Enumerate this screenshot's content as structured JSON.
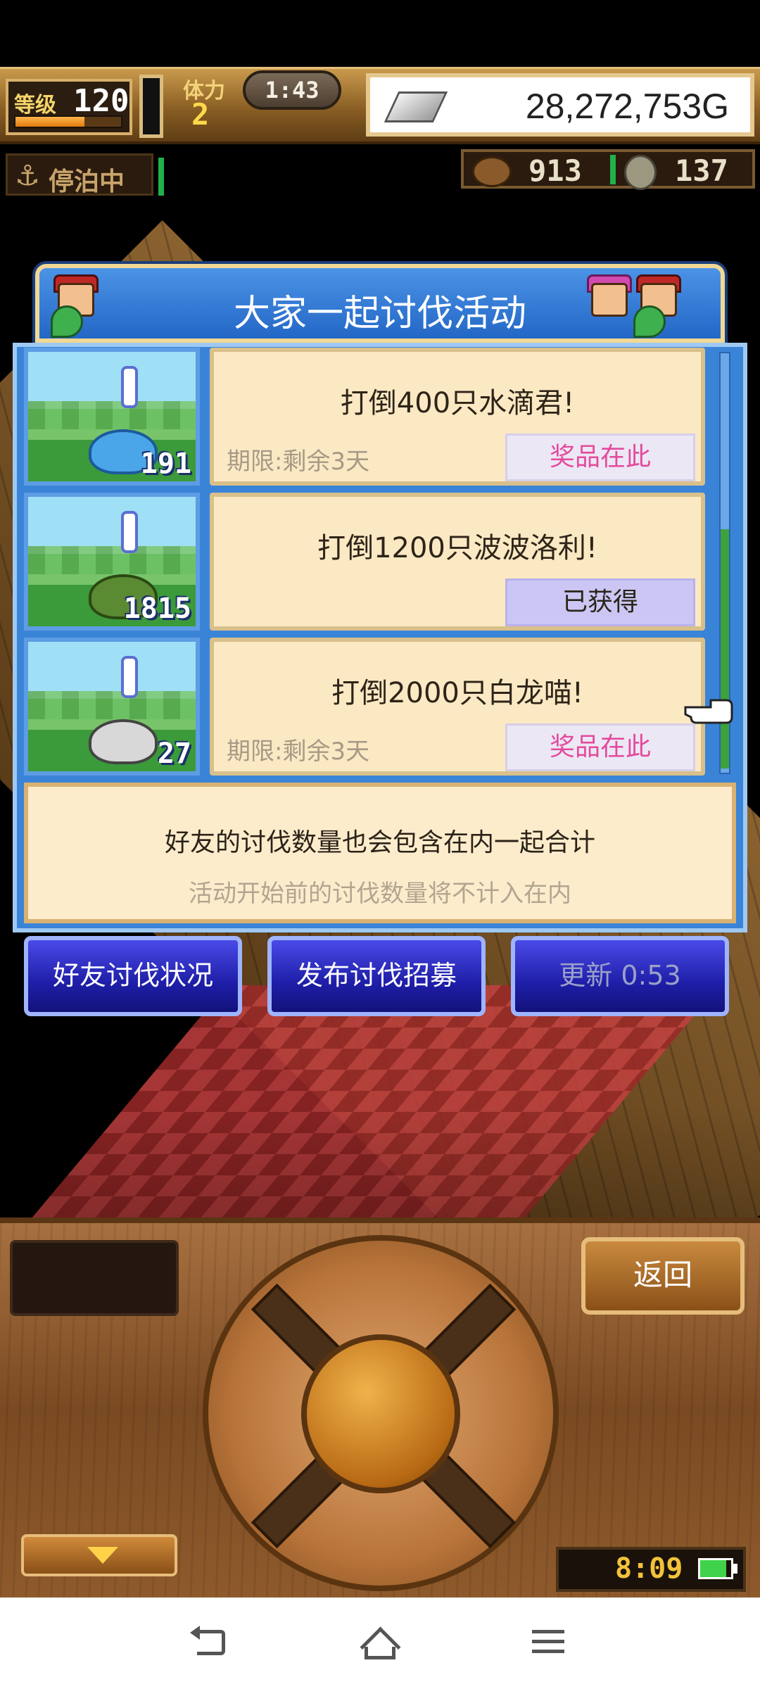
{
  "hud": {
    "level_label": "等级",
    "level_value": "120",
    "exp_fraction": 0.65,
    "stamina_label": "体力",
    "stamina_value": "2",
    "timer": "1:43",
    "gold": "28,272,753G",
    "docked_label": "停泊中",
    "resource_1": "913",
    "resource_2": "137"
  },
  "event": {
    "title": "大家一起讨伐活动",
    "quests": [
      {
        "title": "打倒400只水滴君!",
        "deadline": "期限:剩余3天",
        "reward": "奖品在此",
        "count": "191",
        "monster_icon": "water-droplet-monster-icon",
        "claimed": false
      },
      {
        "title": "打倒1200只波波洛利!",
        "deadline": "",
        "reward": "已获得",
        "count": "1815",
        "monster_icon": "bobo-monster-icon",
        "claimed": true
      },
      {
        "title": "打倒2000只白龙喵!",
        "deadline": "期限:剩余3天",
        "reward": "奖品在此",
        "count": "27",
        "monster_icon": "white-dragon-cat-icon",
        "claimed": false
      }
    ],
    "info_line1": "好友的讨伐数量也会包含在内一起合计",
    "info_line2": "活动开始前的讨伐数量将不计入在内",
    "buttons": {
      "friend_status": "好友讨伐状况",
      "post_recruit": "发布讨伐招募",
      "refresh": "更新 0:53"
    }
  },
  "controls": {
    "return_label": "返回",
    "clock": "8:09",
    "battery_fraction": 0.85
  },
  "colors": {
    "panel_blue": "#3a84d8",
    "card_cream": "#fbe9c4",
    "reward_pink": "#e44a9c",
    "button_blue": "#1e1ea8"
  }
}
